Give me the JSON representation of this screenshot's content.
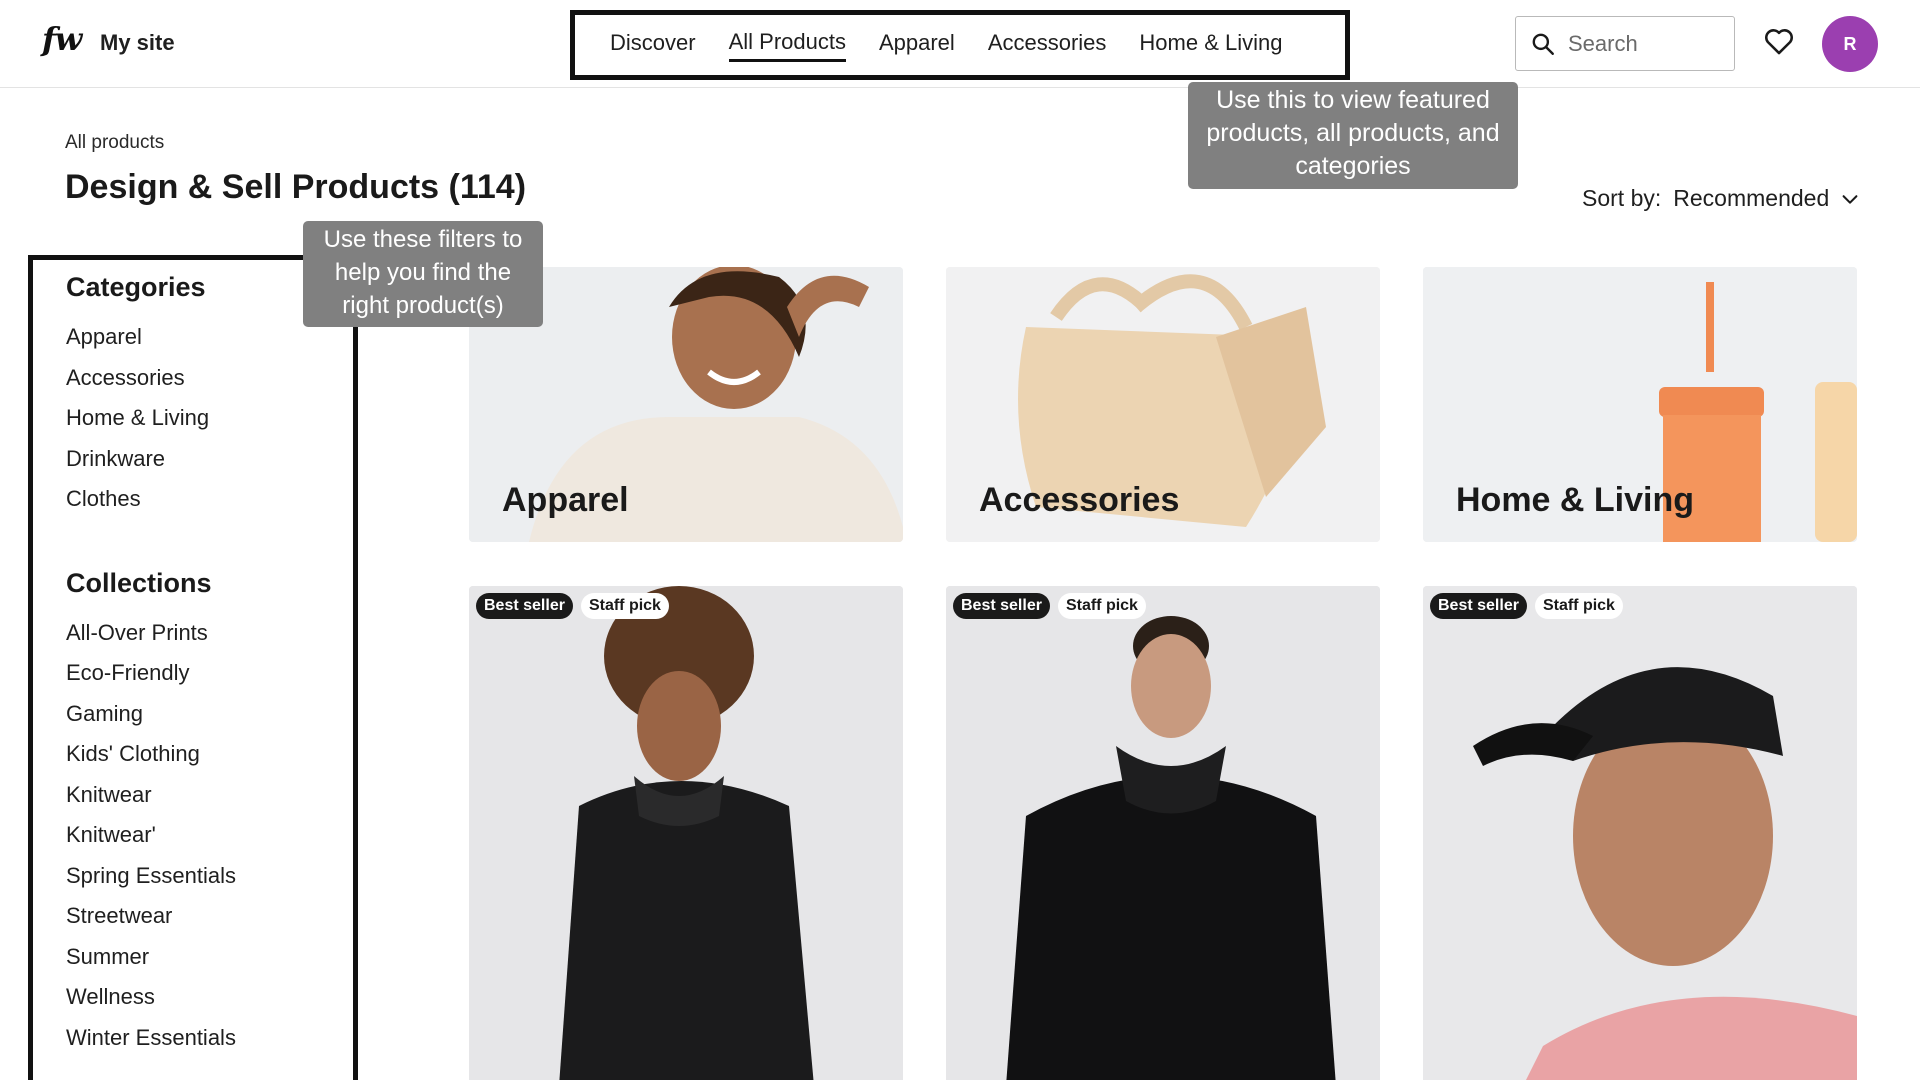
{
  "header": {
    "logo": "fw",
    "site_name": "My site",
    "nav": [
      {
        "label": "Discover",
        "active": false
      },
      {
        "label": "All Products",
        "active": true
      },
      {
        "label": "Apparel",
        "active": false
      },
      {
        "label": "Accessories",
        "active": false
      },
      {
        "label": "Home & Living",
        "active": false
      }
    ],
    "search_placeholder": "Search",
    "avatar_initial": "R",
    "avatar_color": "#9b3fb0"
  },
  "tooltips": {
    "nav": "Use this to view featured products, all products, and categories",
    "filters": "Use these filters to help you find the right product(s)"
  },
  "breadcrumb": "All products",
  "page_title": "Design & Sell Products (114)",
  "sort": {
    "label": "Sort by:",
    "value": "Recommended"
  },
  "sidebar": {
    "categories_heading": "Categories",
    "categories": [
      "Apparel",
      "Accessories",
      "Home & Living",
      "Drinkware",
      "Clothes"
    ],
    "collections_heading": "Collections",
    "collections": [
      "All-Over Prints",
      "Eco-Friendly",
      "Gaming",
      "Kids' Clothing",
      "Knitwear",
      "Knitwear'",
      "Spring Essentials",
      "Streetwear",
      "Summer",
      "Wellness",
      "Winter Essentials"
    ]
  },
  "category_cards": [
    {
      "label": "Apparel"
    },
    {
      "label": "Accessories"
    },
    {
      "label": "Home & Living"
    }
  ],
  "products": [
    {
      "badges": [
        "Best seller",
        "Staff pick"
      ],
      "image": "woman-black-hoodie"
    },
    {
      "badges": [
        "Best seller",
        "Staff pick"
      ],
      "image": "man-black-hoodie"
    },
    {
      "badges": [
        "Best seller",
        "Staff pick"
      ],
      "image": "man-black-cap"
    }
  ]
}
